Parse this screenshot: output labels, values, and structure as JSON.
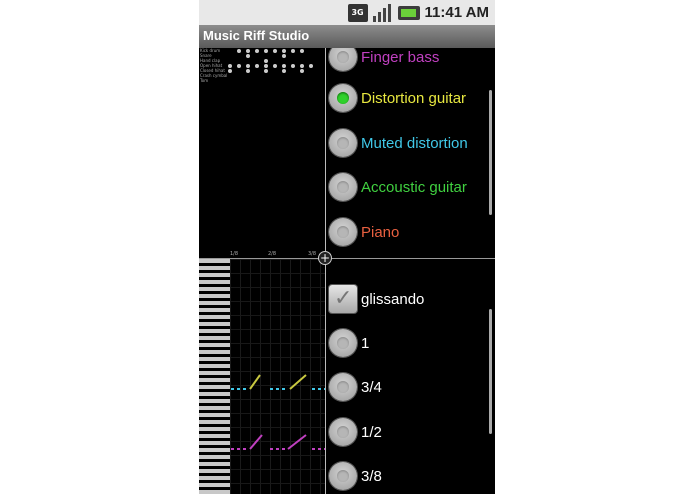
{
  "status_bar": {
    "network": "3G",
    "time": "11:41 AM"
  },
  "app": {
    "title": "Music Riff Studio"
  },
  "drum_pane": {
    "instruments": [
      "Kick drum",
      "Snare",
      "Hand clap",
      "Open hihat",
      "Closed hihat",
      "Crash cymbal",
      "Tom"
    ]
  },
  "piano_roll": {
    "ruler_labels": [
      "1/8",
      "2/8",
      "3/8"
    ]
  },
  "instrument_list": {
    "items": [
      {
        "label": "Finger bass",
        "color": "#c040c0",
        "selected": false
      },
      {
        "label": "Distortion guitar",
        "color": "#e8e840",
        "selected": true
      },
      {
        "label": "Muted distortion",
        "color": "#40c8e8",
        "selected": false
      },
      {
        "label": "Accoustic guitar",
        "color": "#40d040",
        "selected": false
      },
      {
        "label": "Piano",
        "color": "#e86040",
        "selected": false
      }
    ]
  },
  "option_list": {
    "glissando": {
      "label": "glissando",
      "checked": true
    },
    "durations": [
      {
        "label": "1",
        "selected": false
      },
      {
        "label": "3/4",
        "selected": false
      },
      {
        "label": "1/2",
        "selected": false
      },
      {
        "label": "3/8",
        "selected": false
      }
    ]
  },
  "colors": {
    "statusbar_bg": "#e8e8e8",
    "titlebar_bg": "#707070",
    "note_cyan": "#40c8e8",
    "note_yellow": "#c8c840",
    "note_magenta": "#c040c0"
  }
}
